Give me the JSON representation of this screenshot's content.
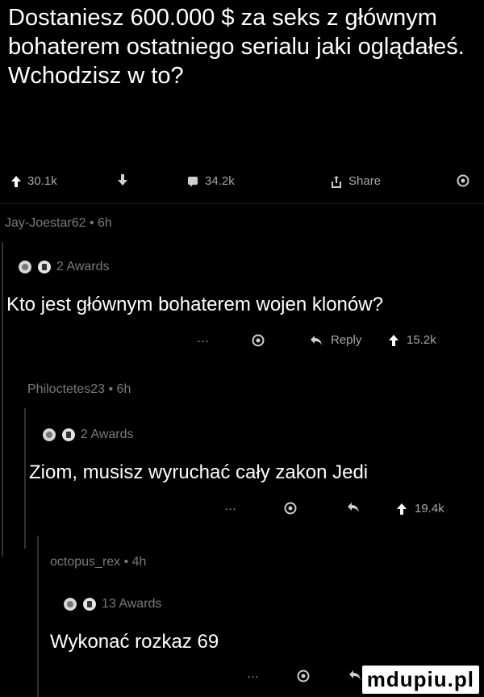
{
  "post": {
    "title": "Dostaniesz 600.000 $ za seks z głównym bohaterem ostatniego serialu jaki oglądałeś. Wchodzisz w to?",
    "upvotes": "30.1k",
    "comments": "34.2k",
    "share_label": "Share"
  },
  "comments": [
    {
      "author_line": "Jay-Joestar62 • 6h",
      "awards": "2 Awards",
      "text": "Kto jest głównym bohaterem wojen klonów?",
      "more": "···",
      "reply_label": "Reply",
      "score": "15.2k"
    },
    {
      "author_line": "Philoctetes23 • 6h",
      "awards": "2 Awards",
      "text": "Ziom, musisz wyruchać cały zakon Jedi",
      "more": "···",
      "score": "19.4k"
    },
    {
      "author_line": "octopus_rex • 4h",
      "awards": "13 Awards",
      "text": "Wykonać rozkaz 69",
      "more": "···"
    }
  ],
  "watermark": "mdupiu.pl",
  "colors": {
    "background": "#000000",
    "muted": "#7a7a7a",
    "actions": "#a8a8a8"
  }
}
